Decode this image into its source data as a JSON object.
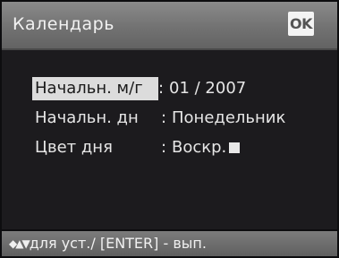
{
  "header": {
    "title": "Календарь",
    "ok_label": "OK"
  },
  "settings": [
    {
      "label": "Начальн. м/г",
      "separator": ":",
      "value": "01 / 2007"
    },
    {
      "label": "Начальн. дн",
      "separator": ":",
      "value": "Понедельник"
    },
    {
      "label": "Цвет дня",
      "separator": ":",
      "value": "Воскр."
    }
  ],
  "selected_row": 0,
  "footer": {
    "nav_icon": "◆▲▼",
    "hint": "для уст./ [ENTER] - вып."
  },
  "colors": {
    "background": "#1c1b1e",
    "bar": "#727272",
    "highlight": "#dcdcdc",
    "text": "#e6e6e6",
    "day_color_swatch": "#e8e8e8"
  },
  "icons": {
    "ok": "ok-icon",
    "navigation": "arrows-icon",
    "day_color": "color-swatch-icon"
  }
}
